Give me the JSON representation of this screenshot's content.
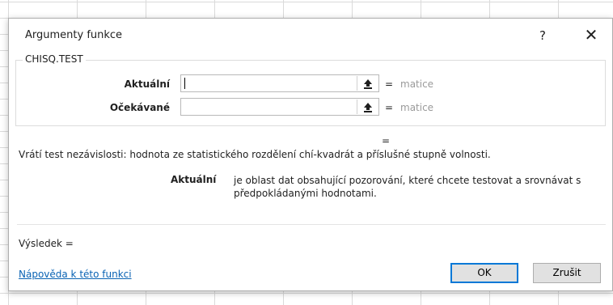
{
  "dialog": {
    "title": "Argumenty funkce",
    "help_label": "?",
    "close_label": "✕"
  },
  "function_group": {
    "name": "CHISQ.TEST",
    "arguments": [
      {
        "label": "Aktuální",
        "value": "",
        "equals": "=",
        "result": "matice"
      },
      {
        "label": "Očekávané",
        "value": "",
        "equals": "=",
        "result": "matice"
      }
    ],
    "reference_icon": "collapse-arrow-icon"
  },
  "function_result_equals": "=",
  "description": "Vrátí test nezávislosti: hodnota ze statistického rozdělení chí-kvadrát a příslušné stupně volnosti.",
  "argument_help": {
    "name": "Aktuální",
    "text": "je oblast dat obsahující pozorování, které chcete testovat a srovnávat s předpokládanými hodnotami."
  },
  "result_label": "Výsledek =",
  "help_link": "Nápověda k této funkci",
  "buttons": {
    "ok": "OK",
    "cancel": "Zrušit"
  },
  "colors": {
    "accent": "#0078d7",
    "link": "#0a63b4"
  }
}
